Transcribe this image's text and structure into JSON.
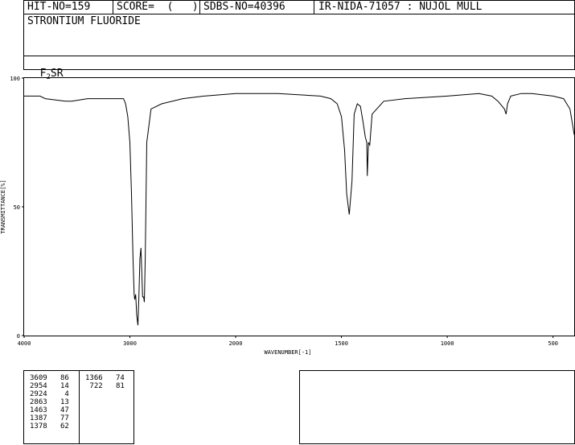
{
  "header": {
    "hit_no": "HIT-NO=159",
    "score": "SCORE=  (   )",
    "sdbs_no": "SDBS-NO=40396",
    "ir_info": "IR-NIDA-71057 : NUJOL MULL",
    "compound_name": "STRONTIUM FLUORIDE",
    "formula_main": "F",
    "formula_sub": "2",
    "formula_tail": "SR"
  },
  "chart_data": {
    "type": "line",
    "xlabel": "WAVENUMBER[-1]",
    "ylabel": "TRANSMITTANCE[%]",
    "xlim": [
      4000,
      400
    ],
    "ylim": [
      0,
      100
    ],
    "x_ticks": [
      4000,
      3000,
      2000,
      1500,
      1000,
      500
    ],
    "y_ticks": [
      0,
      50,
      100
    ],
    "series": [
      {
        "x": [
          4000,
          3850,
          3800,
          3609,
          3550,
          3400,
          3300,
          3100,
          3060,
          3040,
          3020,
          3000,
          2985,
          2970,
          2960,
          2954,
          2945,
          2935,
          2924,
          2915,
          2905,
          2895,
          2880,
          2870,
          2863,
          2855,
          2840,
          2800,
          2700,
          2500,
          2300,
          2000,
          1800,
          1600,
          1550,
          1520,
          1500,
          1485,
          1475,
          1463,
          1450,
          1440,
          1425,
          1410,
          1398,
          1387,
          1380,
          1378,
          1372,
          1366,
          1355,
          1300,
          1200,
          1000,
          850,
          790,
          760,
          730,
          722,
          715,
          700,
          650,
          600,
          500,
          450,
          420,
          410,
          400
        ],
        "y": [
          93,
          93,
          92,
          91,
          91,
          92,
          92,
          92,
          92,
          90,
          85,
          75,
          55,
          30,
          16,
          14,
          16,
          8,
          4,
          15,
          30,
          34,
          15,
          15,
          13,
          30,
          75,
          88,
          90,
          92,
          93,
          94,
          94,
          93,
          92,
          90,
          85,
          72,
          55,
          47,
          60,
          86,
          90,
          89,
          83,
          77,
          75,
          62,
          75,
          74,
          86,
          91,
          92,
          93,
          94,
          93,
          91,
          88,
          86,
          90,
          93,
          94,
          94,
          93,
          92,
          88,
          83,
          78
        ]
      }
    ],
    "peak_table": [
      {
        "wavenumber": "3609",
        "transmittance": "86"
      },
      {
        "wavenumber": "2954",
        "transmittance": "14"
      },
      {
        "wavenumber": "2924",
        "transmittance": "4"
      },
      {
        "wavenumber": "2863",
        "transmittance": "13"
      },
      {
        "wavenumber": "1463",
        "transmittance": "47"
      },
      {
        "wavenumber": "1387",
        "transmittance": "77"
      },
      {
        "wavenumber": "1378",
        "transmittance": "62"
      },
      {
        "wavenumber": "1366",
        "transmittance": "74"
      },
      {
        "wavenumber": "722",
        "transmittance": "81"
      }
    ]
  }
}
